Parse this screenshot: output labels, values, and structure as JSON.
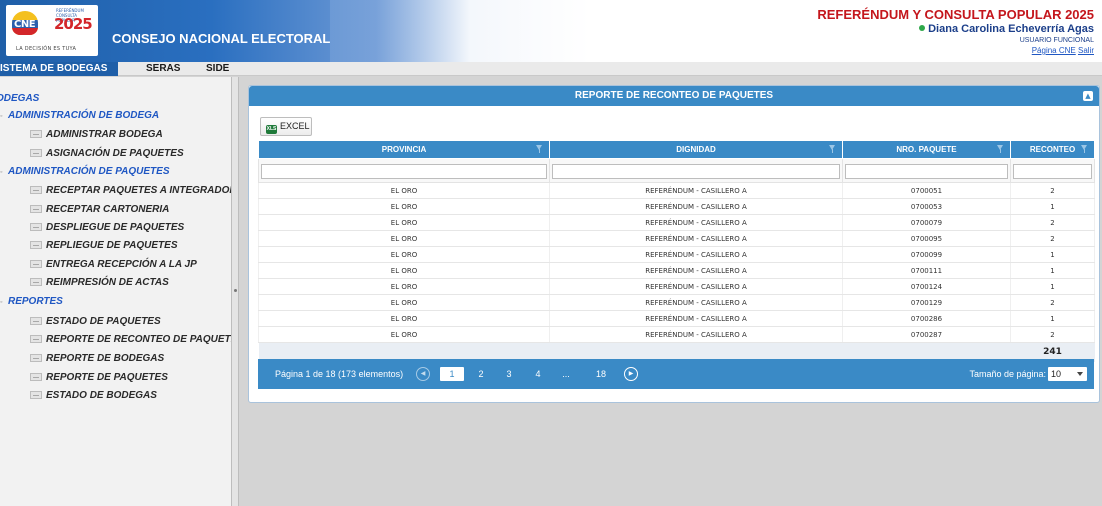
{
  "header": {
    "logo": {
      "acronym": "CNE",
      "year": "2025",
      "badge": "REFERÉNDUM CONSULTA POPULAR",
      "tagline": "LA DECISIÓN ES TUYA"
    },
    "org_title": "CONSEJO NACIONAL ELECTORAL",
    "event_title": "REFERÉNDUM Y CONSULTA POPULAR 2025",
    "user_name": "Diana Carolina Echeverría Agas",
    "user_role": "USUARIO FUNCIONAL",
    "link_cne": "Página CNE",
    "link_logout": "Salir"
  },
  "nav": {
    "items": [
      {
        "label": "ISTEMA DE BODEGAS",
        "active": true
      },
      {
        "label": "SERAS",
        "active": false
      },
      {
        "label": "SIDE",
        "active": false
      }
    ]
  },
  "sidebar": {
    "root": "ODEGAS",
    "groups": [
      {
        "label": "ADMINISTRACIÓN DE BODEGA",
        "items": [
          "ADMINISTRAR BODEGA",
          "ASIGNACIÓN DE PAQUETES"
        ]
      },
      {
        "label": "ADMINISTRACIÓN DE PAQUETES",
        "items": [
          "RECEPTAR PAQUETES A INTEGRADORA",
          "RECEPTAR CARTONERIA",
          "DESPLIEGUE DE PAQUETES",
          "REPLIEGUE DE PAQUETES",
          "ENTREGA RECEPCIÓN A LA JP",
          "REIMPRESIÓN DE ACTAS"
        ]
      },
      {
        "label": "REPORTES",
        "items": [
          "ESTADO DE PAQUETES",
          "REPORTE DE RECONTEO DE PAQUETES",
          "REPORTE DE BODEGAS",
          "REPORTE DE PAQUETES",
          "ESTADO DE BODEGAS"
        ]
      }
    ]
  },
  "panel": {
    "title": "REPORTE DE RECONTEO DE PAQUETES",
    "excel_label": "EXCEL",
    "columns": [
      "PROVINCIA",
      "DIGNIDAD",
      "NRO. PAQUETE",
      "RECONTEO"
    ],
    "rows": [
      [
        "EL ORO",
        "REFERÉNDUM - CASILLERO A",
        "0700051",
        "2"
      ],
      [
        "EL ORO",
        "REFERÉNDUM - CASILLERO A",
        "0700053",
        "1"
      ],
      [
        "EL ORO",
        "REFERÉNDUM - CASILLERO A",
        "0700079",
        "2"
      ],
      [
        "EL ORO",
        "REFERÉNDUM - CASILLERO A",
        "0700095",
        "2"
      ],
      [
        "EL ORO",
        "REFERÉNDUM - CASILLERO A",
        "0700099",
        "1"
      ],
      [
        "EL ORO",
        "REFERÉNDUM - CASILLERO A",
        "0700111",
        "1"
      ],
      [
        "EL ORO",
        "REFERÉNDUM - CASILLERO A",
        "0700124",
        "1"
      ],
      [
        "EL ORO",
        "REFERÉNDUM - CASILLERO A",
        "0700129",
        "2"
      ],
      [
        "EL ORO",
        "REFERÉNDUM - CASILLERO A",
        "0700286",
        "1"
      ],
      [
        "EL ORO",
        "REFERÉNDUM - CASILLERO A",
        "0700287",
        "2"
      ]
    ],
    "total": "241",
    "pager": {
      "info": "Página 1 de 18 (173 elementos)",
      "pages": [
        "1",
        "2",
        "3",
        "4",
        "...",
        "18"
      ],
      "current": "1",
      "size_label": "Tamaño de página:",
      "size_value": "10"
    }
  },
  "colors": {
    "header_blue": "#1f5fa8",
    "grid_blue": "#3a8ac6",
    "title_red": "#c4161c",
    "link_blue": "#1f57c3",
    "online_green": "#2ea84a"
  }
}
